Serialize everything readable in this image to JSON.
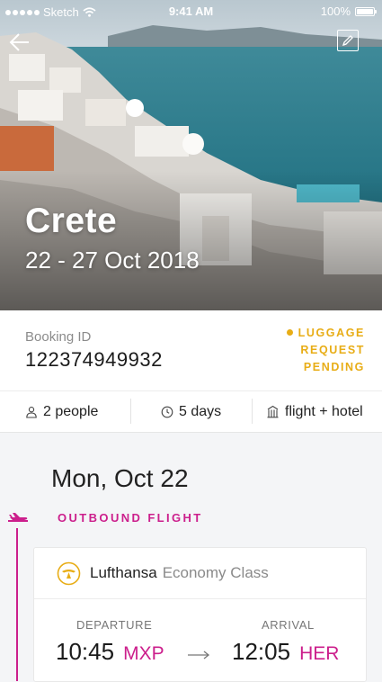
{
  "status_bar": {
    "carrier": "Sketch",
    "time": "9:41 AM",
    "battery": "100%",
    "battery_level": 1.0
  },
  "hero": {
    "title": "Crete",
    "dates": "22 - 27 Oct 2018",
    "back_icon": "back-arrow-icon",
    "edit_icon": "pencil-icon"
  },
  "booking": {
    "id_label": "Booking ID",
    "id_value": "122374949932",
    "luggage_status": [
      "LUGGAGE",
      "REQUEST",
      "PENDING"
    ],
    "status_color": "#e8ad16",
    "facts": {
      "people": "2 people",
      "duration": "5 days",
      "package": "flight + hotel"
    }
  },
  "itinerary": {
    "day": "Mon, Oct 22",
    "section_label": "OUTBOUND FLIGHT",
    "accent_color": "#cc1f8c",
    "flight": {
      "airline": "Lufthansa",
      "class": "Economy Class",
      "departure_label": "DEPARTURE",
      "arrival_label": "ARRIVAL",
      "departure_time": "10:45",
      "departure_code": "MXP",
      "arrival_time": "12:05",
      "arrival_code": "HER"
    }
  }
}
